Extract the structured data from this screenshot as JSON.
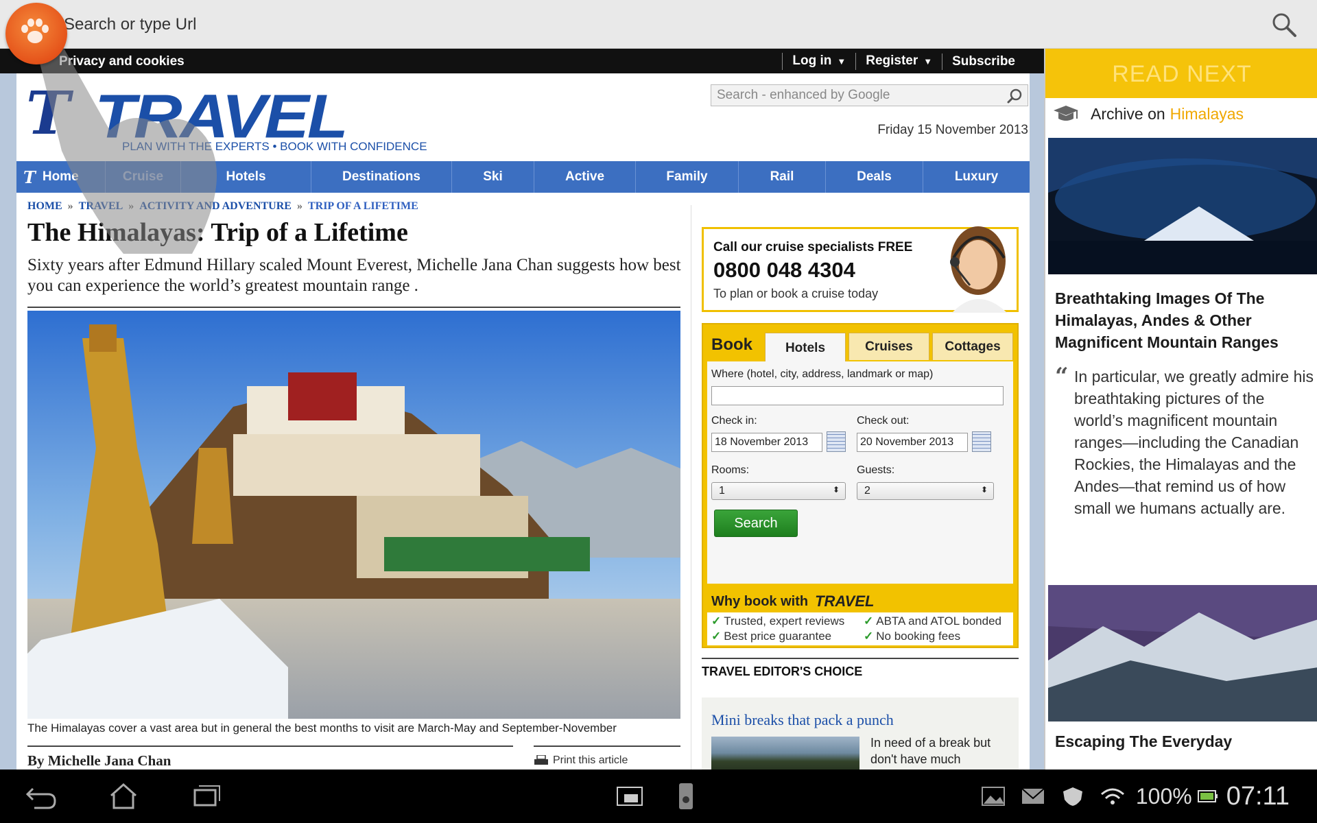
{
  "browser": {
    "url_placeholder": "Search or type Url"
  },
  "topbar": {
    "privacy": "Privacy and cookies",
    "login": "Log in",
    "register": "Register",
    "subscribe": "Subscribe"
  },
  "masthead": {
    "logo_letter": "T",
    "logo_word": "TRAVEL",
    "tagline": "PLAN WITH THE EXPERTS • BOOK WITH CONFIDENCE",
    "search_placeholder": "Search - enhanced by Google",
    "date": "Friday 15 November 2013"
  },
  "nav": {
    "items": [
      "Home",
      "Cruise",
      "Hotels",
      "Destinations",
      "Ski",
      "Active",
      "Family",
      "Rail",
      "Deals",
      "Luxury"
    ]
  },
  "breadcrumb": [
    "HOME",
    "TRAVEL",
    "ACTIVITY AND ADVENTURE",
    "TRIP OF A LIFETIME"
  ],
  "article": {
    "headline": "The Himalayas: Trip of a Lifetime",
    "standfirst": "Sixty years after Edmund Hillary scaled Mount Everest, Michelle Jana Chan suggests how best you can experience the world’s greatest mountain range .",
    "caption": "The Himalayas cover a vast area but in general the best months to visit are March-May and September-November",
    "byline": "By Michelle Jana Chan",
    "print": "Print this article"
  },
  "cruise_ad": {
    "line1": "Call our cruise specialists FREE",
    "phone": "0800 048 4304",
    "line3": "To plan or book a cruise today"
  },
  "booking": {
    "title": "Book",
    "tabs": [
      "Hotels",
      "Cruises",
      "Cottages"
    ],
    "where_label": "Where (hotel, city, address, landmark or map)",
    "where_value": "",
    "checkin_label": "Check in:",
    "checkin_value": "18 November 2013",
    "checkout_label": "Check out:",
    "checkout_value": "20 November 2013",
    "rooms_label": "Rooms:",
    "rooms_value": "1",
    "guests_label": "Guests:",
    "guests_value": "2",
    "search_label": "Search",
    "why_label": "Why book with",
    "why_logo": "TRAVEL",
    "benefits": [
      "Trusted, expert reviews",
      "ABTA and ATOL bonded",
      "Best price guarantee",
      "No booking fees"
    ]
  },
  "editors_choice": {
    "heading": "TRAVEL EDITOR'S CHOICE",
    "item_title": "Mini breaks that pack a punch",
    "item_text": "In need of a break but don't have much"
  },
  "sidebar": {
    "header": "READ NEXT",
    "archive_prefix": "Archive on",
    "archive_topic": "Himalayas",
    "story1_title": "Breathtaking Images Of The Himalayas, Andes & Other Magnificent Mountain Ranges",
    "story1_quote": "In particular, we greatly admire his breathtaking pictures of the world’s magnificent mountain ranges—including the Canadian Rockies, the Himalayas and the Andes—that remind us of how small we humans actually are.",
    "story2_title": "Escaping The Everyday"
  },
  "statusbar": {
    "battery": "100%",
    "time": "07:11"
  },
  "colors": {
    "nav_blue": "#3c6fc1",
    "brand_blue": "#1b4fa8",
    "read_next_yellow": "#f5c30a",
    "book_yellow": "#f2c200",
    "search_green": "#2a922a"
  }
}
